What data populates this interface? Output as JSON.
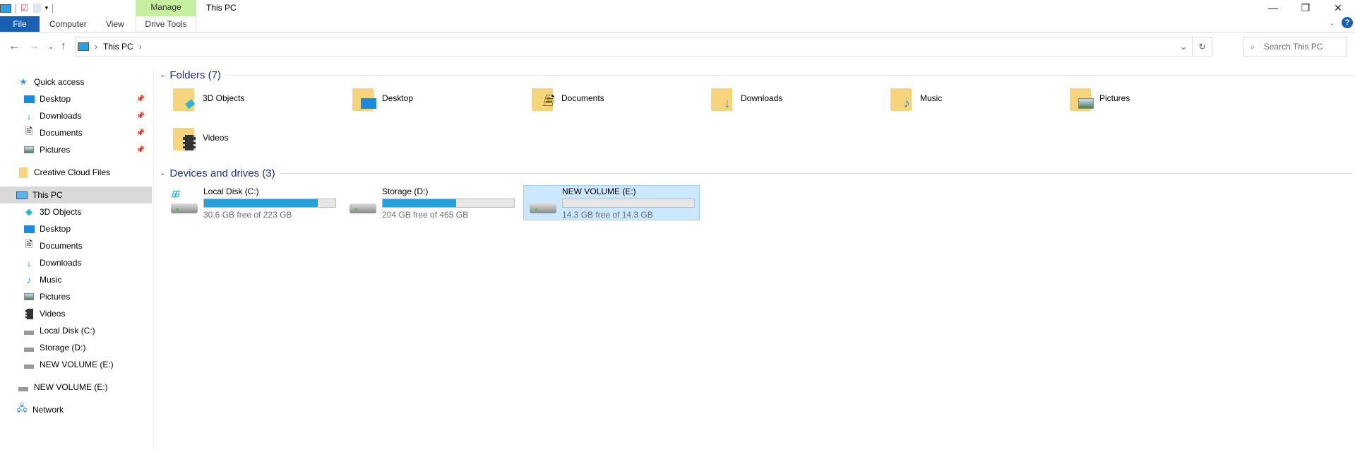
{
  "window": {
    "title": "This PC",
    "context_group": "Manage"
  },
  "ribbon": {
    "tabs": [
      {
        "label": "File"
      },
      {
        "label": "Computer"
      },
      {
        "label": "View"
      },
      {
        "label": "Drive Tools"
      }
    ]
  },
  "address": {
    "path": [
      "This PC"
    ]
  },
  "search": {
    "placeholder": "Search This PC"
  },
  "sidebar": {
    "quick_access": "Quick access",
    "quick_items": [
      {
        "label": "Desktop",
        "icon": "desktop-icon"
      },
      {
        "label": "Downloads",
        "icon": "downloads-icon"
      },
      {
        "label": "Documents",
        "icon": "documents-icon"
      },
      {
        "label": "Pictures",
        "icon": "pictures-icon"
      }
    ],
    "creative_cloud": "Creative Cloud Files",
    "this_pc": "This PC",
    "pc_items": [
      {
        "label": "3D Objects"
      },
      {
        "label": "Desktop"
      },
      {
        "label": "Documents"
      },
      {
        "label": "Downloads"
      },
      {
        "label": "Music"
      },
      {
        "label": "Pictures"
      },
      {
        "label": "Videos"
      },
      {
        "label": "Local Disk (C:)"
      },
      {
        "label": "Storage (D:)"
      },
      {
        "label": "NEW VOLUME (E:)"
      }
    ],
    "removable": "NEW VOLUME (E:)",
    "network": "Network"
  },
  "main": {
    "folders_header": "Folders (7)",
    "folders": [
      {
        "label": "3D Objects"
      },
      {
        "label": "Desktop"
      },
      {
        "label": "Documents"
      },
      {
        "label": "Downloads"
      },
      {
        "label": "Music"
      },
      {
        "label": "Pictures"
      },
      {
        "label": "Videos"
      }
    ],
    "drives_header": "Devices and drives (3)",
    "drives": [
      {
        "label": "Local Disk (C:)",
        "free": "30.6 GB free of 223 GB",
        "used_percent": 86.3
      },
      {
        "label": "Storage (D:)",
        "free": "204 GB free of 465 GB",
        "used_percent": 56.1
      },
      {
        "label": "NEW VOLUME (E:)",
        "free": "14.3 GB free of 14.3 GB",
        "used_percent": 0
      }
    ]
  },
  "colors": {
    "accent": "#1960b3",
    "bar_fill": "#26a0da",
    "selection": "#cce8ff",
    "context_tab": "#c6efa0"
  }
}
